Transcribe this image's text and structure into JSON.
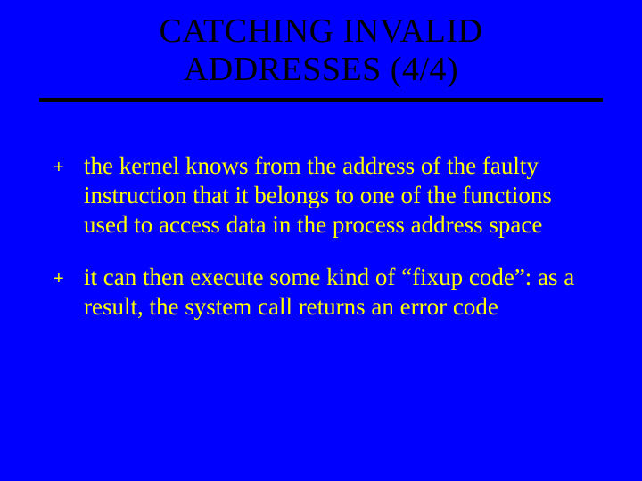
{
  "title_line1": "CATCHING INVALID",
  "title_line2": "ADDRESSES (4/4)",
  "bullets": [
    {
      "marker": "+",
      "text": "the kernel knows from the address of the faulty instruction that it belongs to one of the functions used to access data in the process address space"
    },
    {
      "marker": "+",
      "text": "it can then execute some kind of “fixup code”: as a result, the system call returns an error code"
    }
  ],
  "colors": {
    "background": "#0000ff",
    "title": "#000000",
    "underline": "#000000",
    "body": "#ffff00"
  }
}
